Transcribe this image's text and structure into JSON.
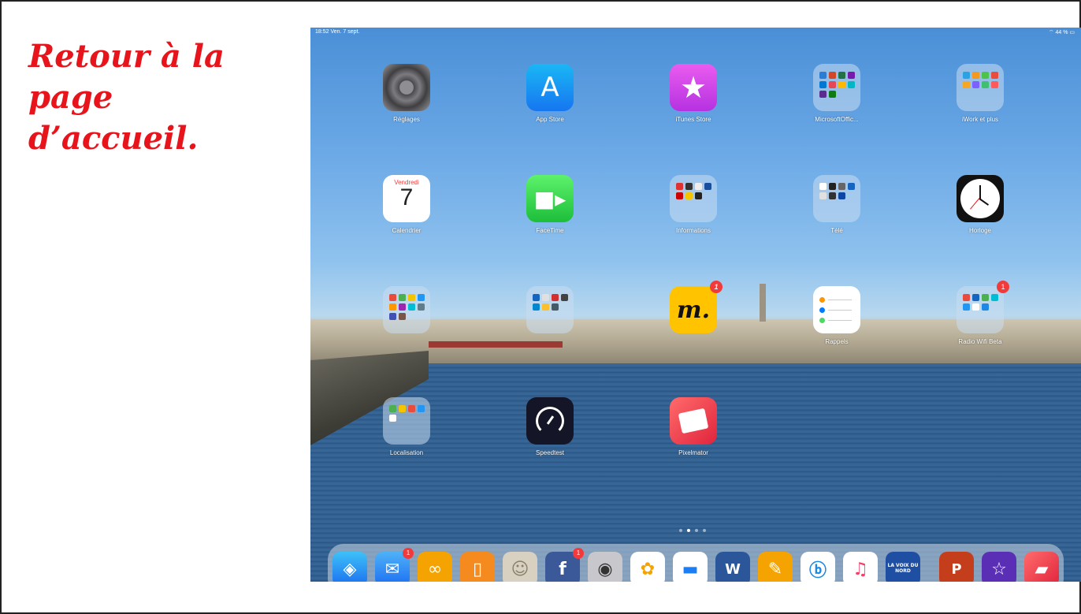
{
  "caption": {
    "line1": "Retour à la",
    "line2": "page",
    "line3": "d’accueil."
  },
  "status": {
    "time": "18:52  Ven. 7 sept.",
    "right": "⌔ 44 % ▭"
  },
  "apps": [
    {
      "label": "Réglages"
    },
    {
      "label": "App Store"
    },
    {
      "label": "iTunes Store"
    },
    {
      "label": "MicrosoftOffic..."
    },
    {
      "label": "iWork et plus"
    },
    {
      "label": "Calendrier",
      "day_name": "Vendredi",
      "day_number": "7"
    },
    {
      "label": "FaceTime"
    },
    {
      "label": "Informations"
    },
    {
      "label": "Télé"
    },
    {
      "label": "Horloge"
    },
    {
      "label": ""
    },
    {
      "label": ""
    },
    {
      "label": "",
      "badge": "1",
      "glyph": "m."
    },
    {
      "label": "Rappels"
    },
    {
      "label": "Radio Wifi Beta",
      "badge": "1"
    },
    {
      "label": "Localisation"
    },
    {
      "label": "Speedtest"
    },
    {
      "label": "Pixelmator"
    }
  ],
  "dock_badges": {
    "mail": "1",
    "facebook": "1"
  },
  "dock_glyphs": {
    "facebook": "f",
    "word": "W",
    "vdn": "LA VOIX DU NORD",
    "powerpoint": "P"
  },
  "colors": {
    "caption": "#e8141b",
    "badge": "#f23a3a"
  }
}
